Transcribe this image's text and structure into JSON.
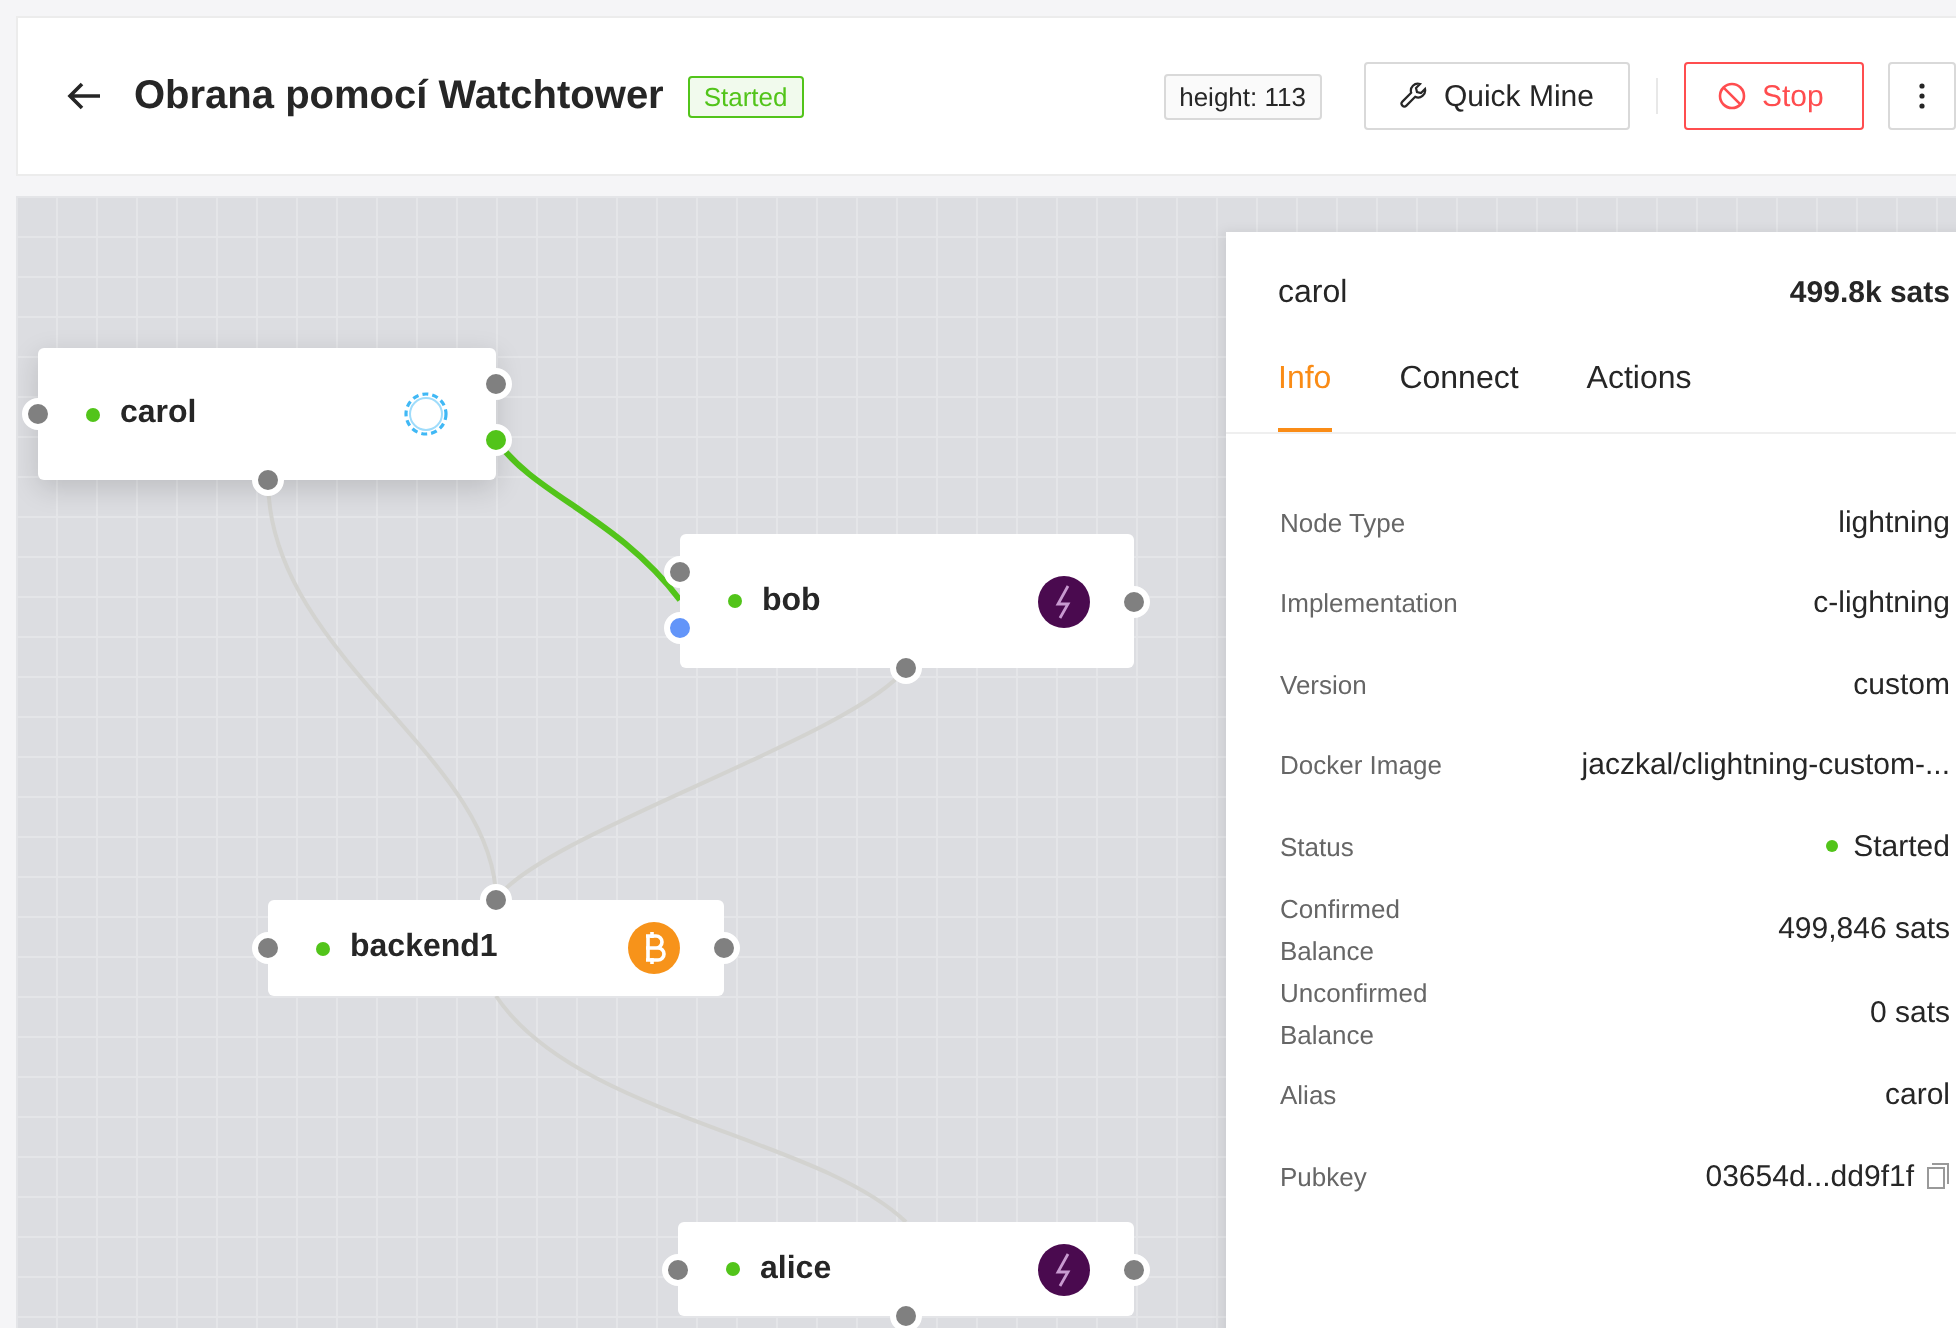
{
  "header": {
    "title": "Obrana pomocí Watchtower",
    "status": {
      "label": "Started",
      "color": "#52c41a"
    },
    "height": "height: 113",
    "buttons": [
      {
        "kind": "mine",
        "label": "Quick Mine"
      },
      {
        "kind": "stop",
        "label": "Stop"
      },
      {
        "kind": "more"
      }
    ]
  },
  "nodes": [
    {
      "name": "carol",
      "kind": "loading",
      "selected": true,
      "color": "#52c41a"
    },
    {
      "name": "bob",
      "kind": "lightning",
      "selected": false,
      "color": "#52c41a"
    },
    {
      "name": "backend1",
      "kind": "bitcoin",
      "selected": false,
      "color": "#52c41a"
    },
    {
      "name": "alice",
      "kind": "lightning",
      "selected": false,
      "color": "#52c41a"
    }
  ],
  "links": [
    {
      "kind": "channel",
      "color": "#52c41a"
    },
    {
      "kind": "backend",
      "color": "#d3d3d0"
    },
    {
      "kind": "backend",
      "color": "#d3d3d0"
    },
    {
      "kind": "backend",
      "color": "#d3d3d0"
    }
  ],
  "panel": {
    "title": "carol",
    "balance": "499.8k sats",
    "tabs": [
      {
        "label": "Info",
        "selected": true
      },
      {
        "label": "Connect",
        "selected": false
      },
      {
        "label": "Actions",
        "selected": false
      }
    ],
    "rows": [
      {
        "label": "Node Type",
        "value": "lightning"
      },
      {
        "label": "Implementation",
        "value": "c-lightning"
      },
      {
        "label": "Version",
        "value": "custom"
      },
      {
        "label": "Docker Image",
        "value": "jaczkal/clightning-custom-..."
      },
      {
        "label": "Status",
        "value": "Started",
        "kind": "status",
        "color": "#52c41a"
      },
      {
        "label": "Confirmed Balance",
        "value": "499,846 sats"
      },
      {
        "label": "Unconfirmed Balance",
        "value": "0 sats"
      },
      {
        "label": "Alias",
        "value": "carol"
      },
      {
        "label": "Pubkey",
        "value": "03654d...dd9f1f",
        "kind": "copy"
      }
    ]
  }
}
